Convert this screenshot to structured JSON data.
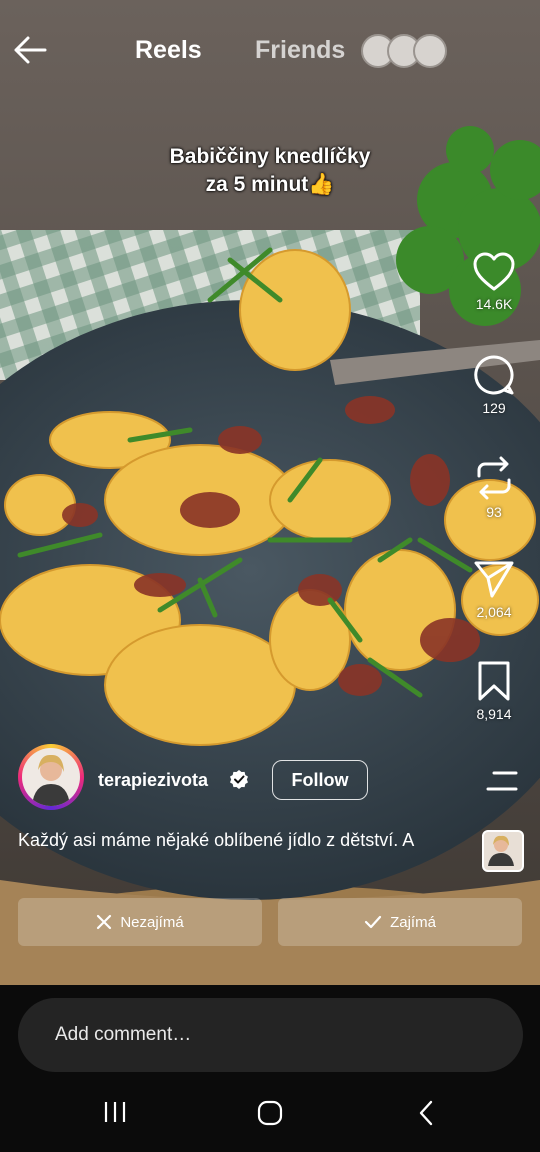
{
  "header": {
    "back_icon": "arrow-left-icon",
    "tabs": [
      {
        "label": "Reels",
        "active": true
      },
      {
        "label": "Friends",
        "active": false
      }
    ]
  },
  "caption": {
    "line1": "Babiččiny knedlíčky",
    "line2": "za 5 minut👍"
  },
  "actions": {
    "like": {
      "icon": "heart-icon",
      "count": "14.6K"
    },
    "comment": {
      "icon": "comment-bubble-icon",
      "count": "129"
    },
    "repost": {
      "icon": "repost-icon",
      "count": "93"
    },
    "share": {
      "icon": "send-icon",
      "count": "2,064"
    },
    "save": {
      "icon": "bookmark-icon",
      "count": "8,914"
    }
  },
  "author": {
    "username": "terapiezivota",
    "verified": true,
    "follow_label": "Follow"
  },
  "description": "Každý asi máme nějaké oblíbené jídlo z dětství. A",
  "feedback": {
    "not_interested": "Nezajímá",
    "interested": "Zajímá"
  },
  "comment_input": {
    "placeholder": "Add comment…"
  },
  "system_nav": [
    "recent-apps-icon",
    "home-icon",
    "back-icon"
  ],
  "colors": {
    "background": "#0b0b0b",
    "input_bg": "#242424",
    "plate": "#3a4750",
    "food": "#f2c24f",
    "bacon": "#8b3a2a",
    "chives": "#3f8a2a"
  }
}
